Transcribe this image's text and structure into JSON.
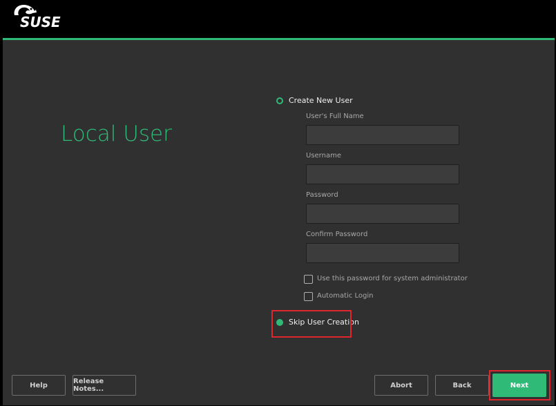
{
  "brand": {
    "logo_text": "SUSE",
    "accent_color": "#30ba78"
  },
  "page": {
    "title": "Local User"
  },
  "create_user": {
    "radio_label": "Create New User",
    "selected": false,
    "full_name_label": "User's Full Name",
    "full_name_value": "",
    "username_label": "Username",
    "username_value": "",
    "password_label": "Password",
    "password_value": "",
    "confirm_password_label": "Confirm Password",
    "confirm_password_value": "",
    "admin_checkbox_label": "Use this password for system administrator",
    "admin_checked": false,
    "autologin_label": "Automatic Login",
    "autologin_checked": false
  },
  "skip_user": {
    "radio_label": "Skip User Creation",
    "selected": true
  },
  "buttons": {
    "help": "Help",
    "release_notes": "Release Notes...",
    "abort": "Abort",
    "back": "Back",
    "next": "Next"
  },
  "highlight_color": "#e0262f"
}
